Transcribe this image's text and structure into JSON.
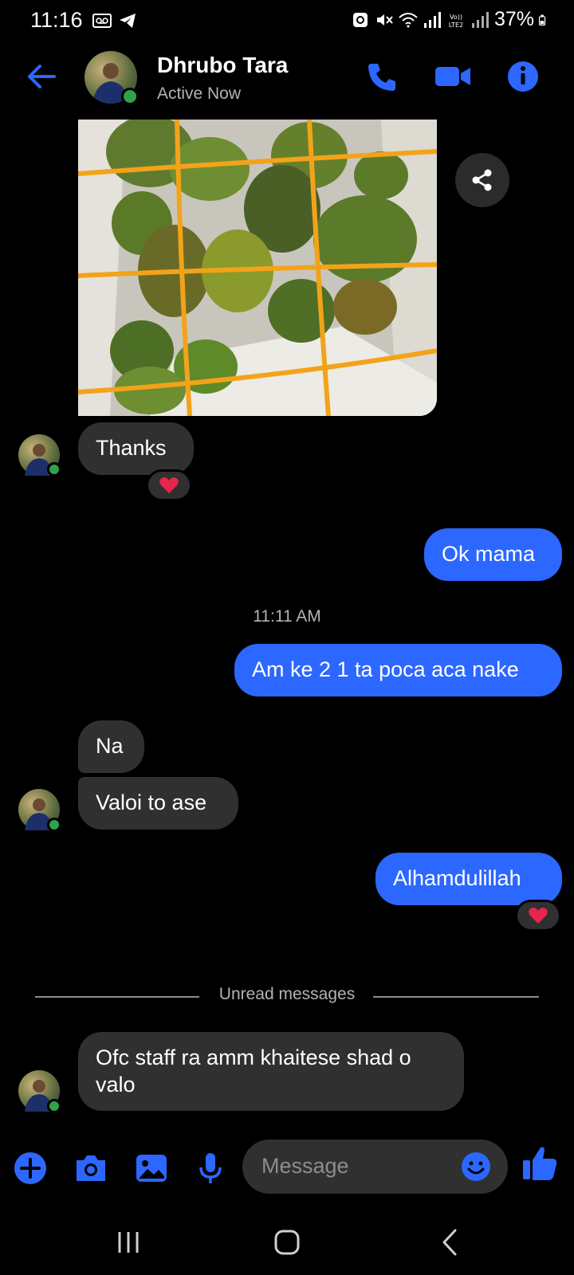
{
  "status_bar": {
    "time": "11:16",
    "battery": "37%"
  },
  "header": {
    "contact_name": "Dhrubo Tara",
    "contact_status": "Active Now"
  },
  "messages": [
    {
      "id": "thanks",
      "direction": "incoming",
      "text": "Thanks",
      "reaction": "heart"
    },
    {
      "id": "ok-mama",
      "direction": "outgoing",
      "text": "Ok mama"
    },
    {
      "id": "am-ke",
      "direction": "outgoing",
      "text": "Am ke 2 1 ta poca aca nake"
    },
    {
      "id": "na",
      "direction": "incoming",
      "text": "Na"
    },
    {
      "id": "valoi",
      "direction": "incoming",
      "text": "Valoi to ase"
    },
    {
      "id": "alhamdulillah",
      "direction": "outgoing",
      "text": "Alhamdulillah",
      "reaction": "heart"
    },
    {
      "id": "ofc-staff",
      "direction": "incoming",
      "text": "Ofc staff ra amm khaitese shad o valo"
    }
  ],
  "timestamp": "11:11 AM",
  "unread_divider": "Unread messages",
  "composer": {
    "placeholder": "Message"
  },
  "colors": {
    "accent": "#2c67ff",
    "incoming_bubble": "#303030",
    "online": "#31a24c",
    "heart": "#e8254a"
  }
}
